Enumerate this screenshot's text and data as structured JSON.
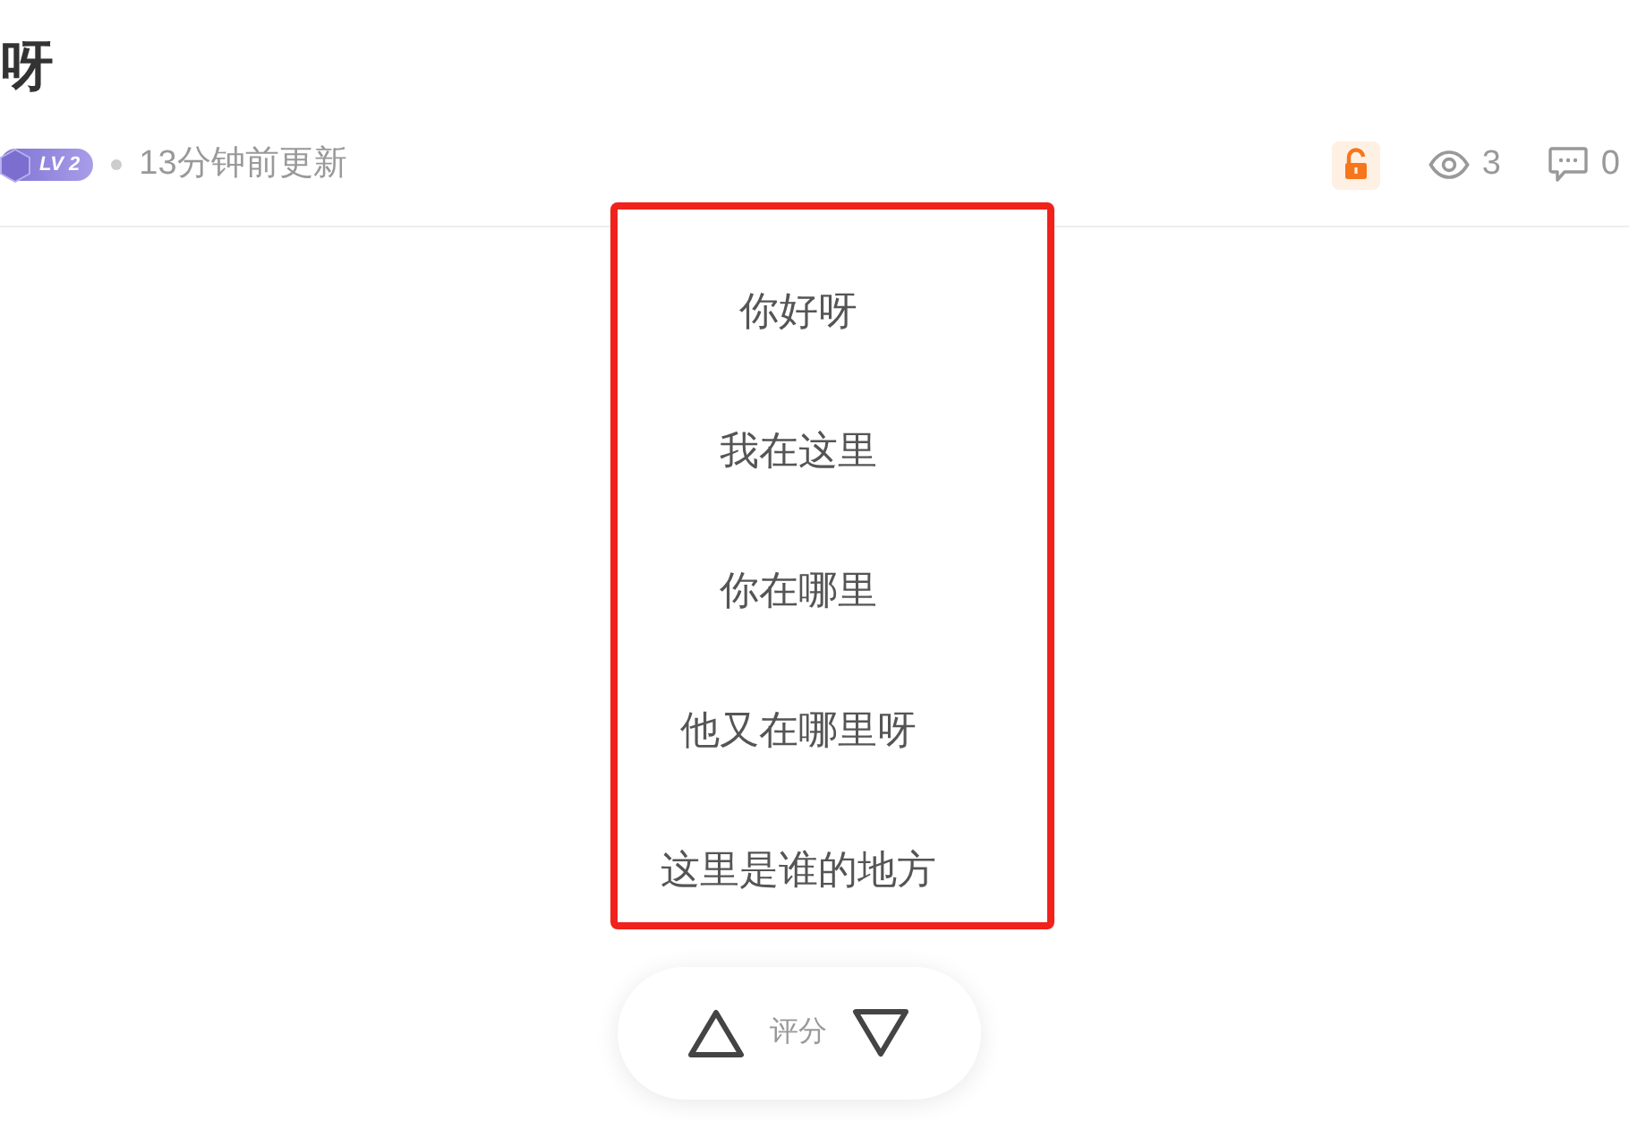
{
  "post": {
    "title": "呀",
    "level_badge": "LV 2",
    "updated": "13分钟前更新",
    "locked": false,
    "views": "3",
    "comments": "0"
  },
  "highlight_box": {
    "lines": [
      "你好呀",
      "我在这里",
      "你在哪里",
      "他又在哪里呀",
      "这里是谁的地方"
    ]
  },
  "rating": {
    "label": "评分"
  }
}
